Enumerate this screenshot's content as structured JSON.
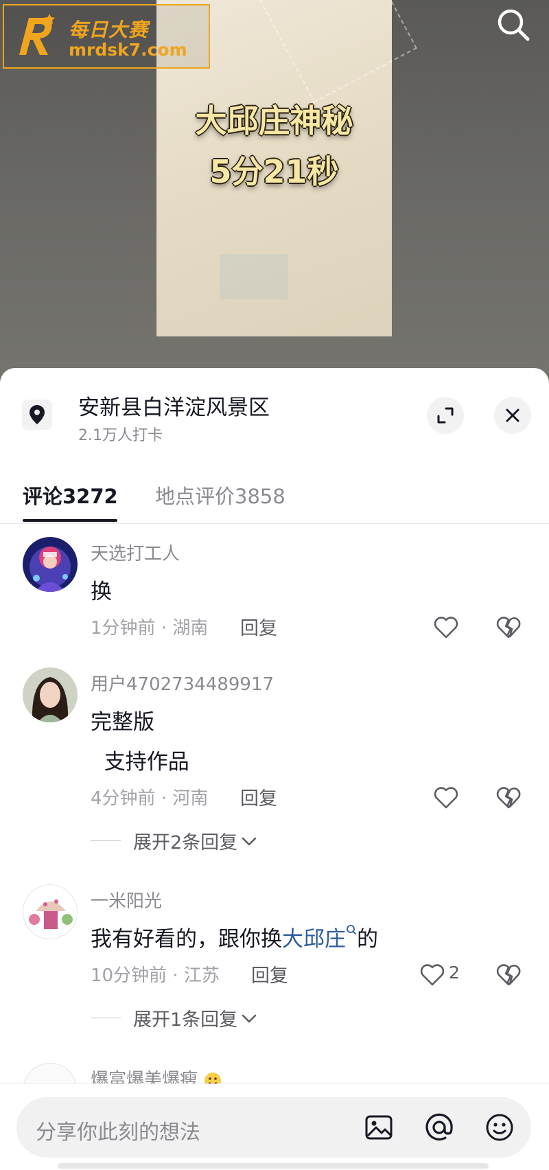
{
  "watermark": {
    "cn": "每日大赛",
    "url": "mrdsk7.com"
  },
  "video": {
    "title_line1": "大邱庄神秘",
    "title_line2": "5分21秒"
  },
  "location": {
    "name": "安新县白洋淀风景区",
    "checkins": "2.1万人打卡"
  },
  "tabs": [
    {
      "label": "评论3272"
    },
    {
      "label": "地点评价3858"
    }
  ],
  "comments": [
    {
      "user": "天选打工人",
      "text": "换",
      "meta": "1分钟前 · 湖南",
      "reply": "回复",
      "likes": ""
    },
    {
      "user": "用户4702734489917",
      "text_line1": "完整版",
      "text_line2": "  支持作品",
      "meta": "4分钟前 · 河南",
      "reply": "回复",
      "likes": "",
      "expand": "展开2条回复"
    },
    {
      "user": "一米阳光",
      "text_before": "我有好看的，跟你换",
      "text_link": "大邱庄",
      "text_after": "的",
      "meta": "10分钟前 · 江苏",
      "reply": "回复",
      "likes": "2",
      "expand": "展开1条回复"
    },
    {
      "user": "爆富爆美爆瘦"
    }
  ],
  "input": {
    "placeholder": "分享你此刻的想法"
  },
  "icons": {
    "search": "search-icon",
    "location": "location-pin-icon",
    "expand": "expand-icon",
    "close": "close-icon",
    "like": "heart-icon",
    "dislike": "broken-heart-icon",
    "image": "image-icon",
    "mention": "at-icon",
    "emoji": "emoji-icon"
  },
  "colors": {
    "watermark": "#f0a51e",
    "hashtag": "#2b5c9e",
    "text": "#161823",
    "muted": "#8a8b91"
  }
}
